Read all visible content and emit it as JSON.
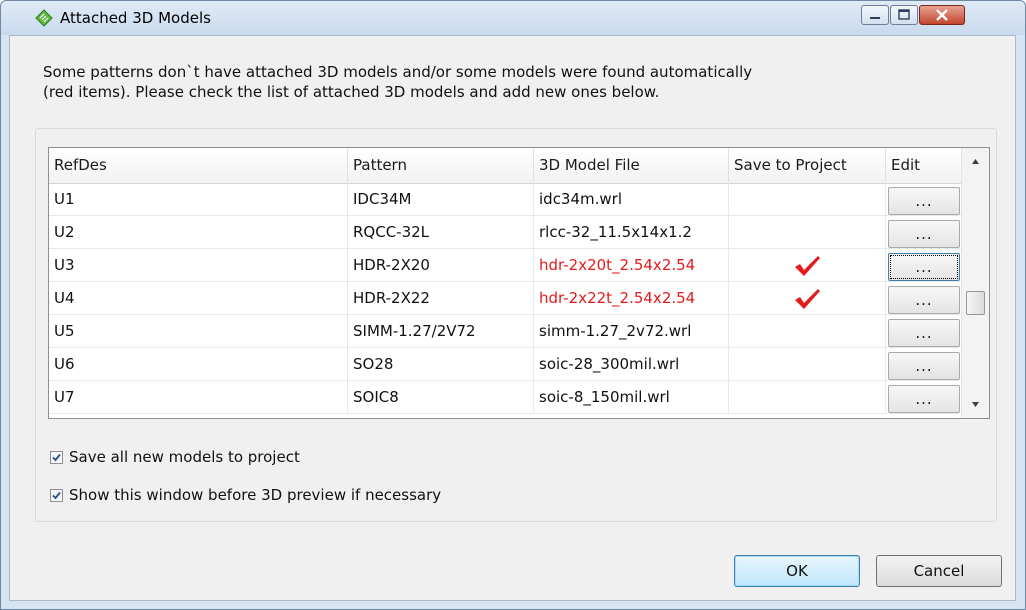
{
  "window": {
    "title": "Attached 3D Models",
    "controls": [
      "minimize-icon",
      "maximize-icon",
      "close-icon"
    ]
  },
  "instructions": {
    "line1": "Some patterns don`t have attached 3D models and/or some models were found automatically",
    "line2": "(red items). Please check the list of attached 3D models and add new ones below."
  },
  "grid": {
    "columns": [
      "RefDes",
      "Pattern",
      "3D Model File",
      "Save to Project",
      "Edit"
    ],
    "rows": [
      {
        "refdes": "U1",
        "pattern": "IDC34M",
        "file": "idc34m.wrl",
        "save": false,
        "red": false,
        "edit": "...",
        "focused": false
      },
      {
        "refdes": "U2",
        "pattern": "RQCC-32L",
        "file": "rlcc-32_11.5x14x1.2",
        "save": false,
        "red": false,
        "edit": "...",
        "focused": false
      },
      {
        "refdes": "U3",
        "pattern": "HDR-2X20",
        "file": "hdr-2x20t_2.54x2.54",
        "save": true,
        "red": true,
        "edit": "...",
        "focused": true
      },
      {
        "refdes": "U4",
        "pattern": "HDR-2X22",
        "file": "hdr-2x22t_2.54x2.54",
        "save": true,
        "red": true,
        "edit": "...",
        "focused": false
      },
      {
        "refdes": "U5",
        "pattern": "SIMM-1.27/2V72",
        "file": "simm-1.27_2v72.wrl",
        "save": false,
        "red": false,
        "edit": "...",
        "focused": false
      },
      {
        "refdes": "U6",
        "pattern": "SO28",
        "file": "soic-28_300mil.wrl",
        "save": false,
        "red": false,
        "edit": "...",
        "focused": false
      },
      {
        "refdes": "U7",
        "pattern": "SOIC8",
        "file": "soic-8_150mil.wrl",
        "save": false,
        "red": false,
        "edit": "...",
        "focused": false
      }
    ],
    "check_icon": "checkmark-icon",
    "check_color": "#e31b1b",
    "scrollbar_position": 0.6
  },
  "options": {
    "save_all": {
      "label": "Save all new models to project",
      "checked": true
    },
    "show_window": {
      "label": "Show this window before 3D preview if necessary",
      "checked": true
    }
  },
  "buttons": {
    "ok": "OK",
    "cancel": "Cancel"
  }
}
